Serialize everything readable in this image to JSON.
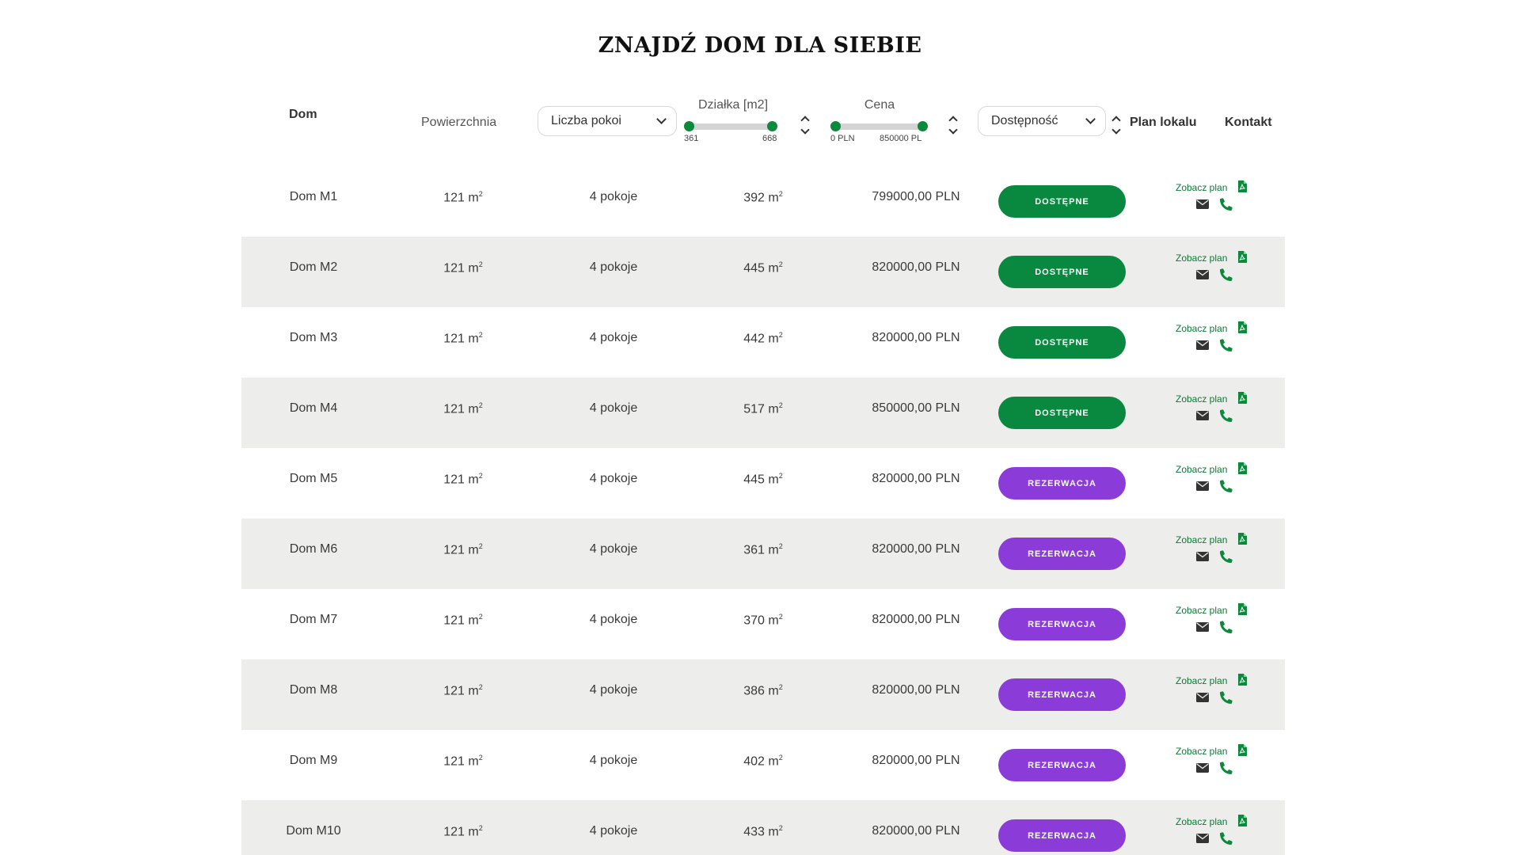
{
  "page_title": "ZNAJDŹ DOM DLA SIEBIE",
  "colors": {
    "accent_green": "#0a8a3a",
    "available": "#08893f",
    "reserved": "#8b3bd8",
    "row_alt_bg": "#ededec"
  },
  "header": {
    "dom": "Dom",
    "powierzchnia": "Powierzchnia",
    "rooms_select": {
      "selected": "Liczba pokoi"
    },
    "plot_range": {
      "label": "Działka [m2]",
      "min": "361",
      "max": "668"
    },
    "price_range": {
      "label": "Cena",
      "min": "0 PLN",
      "max": "850000 PL"
    },
    "availability_select": {
      "selected": "Dostępność"
    },
    "plan": "Plan lokalu",
    "kontakt": "Kontakt"
  },
  "rows": [
    {
      "name": "Dom M1",
      "area": "121 m",
      "rooms": "4 pokoje",
      "plot": "392 m",
      "price": "799000,00 PLN",
      "status": "DOSTĘPNE",
      "status_type": "available",
      "plan_link": "Zobacz plan"
    },
    {
      "name": "Dom M2",
      "area": "121 m",
      "rooms": "4 pokoje",
      "plot": "445 m",
      "price": "820000,00 PLN",
      "status": "DOSTĘPNE",
      "status_type": "available",
      "plan_link": "Zobacz plan"
    },
    {
      "name": "Dom M3",
      "area": "121 m",
      "rooms": "4 pokoje",
      "plot": "442 m",
      "price": "820000,00 PLN",
      "status": "DOSTĘPNE",
      "status_type": "available",
      "plan_link": "Zobacz plan"
    },
    {
      "name": "Dom M4",
      "area": "121 m",
      "rooms": "4 pokoje",
      "plot": "517 m",
      "price": "850000,00 PLN",
      "status": "DOSTĘPNE",
      "status_type": "available",
      "plan_link": "Zobacz plan"
    },
    {
      "name": "Dom M5",
      "area": "121 m",
      "rooms": "4 pokoje",
      "plot": "445 m",
      "price": "820000,00 PLN",
      "status": "REZERWACJA",
      "status_type": "reserved",
      "plan_link": "Zobacz plan"
    },
    {
      "name": "Dom M6",
      "area": "121 m",
      "rooms": "4 pokoje",
      "plot": "361 m",
      "price": "820000,00 PLN",
      "status": "REZERWACJA",
      "status_type": "reserved",
      "plan_link": "Zobacz plan"
    },
    {
      "name": "Dom M7",
      "area": "121 m",
      "rooms": "4 pokoje",
      "plot": "370 m",
      "price": "820000,00 PLN",
      "status": "REZERWACJA",
      "status_type": "reserved",
      "plan_link": "Zobacz plan"
    },
    {
      "name": "Dom M8",
      "area": "121 m",
      "rooms": "4 pokoje",
      "plot": "386 m",
      "price": "820000,00 PLN",
      "status": "REZERWACJA",
      "status_type": "reserved",
      "plan_link": "Zobacz plan"
    },
    {
      "name": "Dom M9",
      "area": "121 m",
      "rooms": "4 pokoje",
      "plot": "402 m",
      "price": "820000,00 PLN",
      "status": "REZERWACJA",
      "status_type": "reserved",
      "plan_link": "Zobacz plan"
    },
    {
      "name": "Dom M10",
      "area": "121 m",
      "rooms": "4 pokoje",
      "plot": "433 m",
      "price": "820000,00 PLN",
      "status": "REZERWACJA",
      "status_type": "reserved",
      "plan_link": "Zobacz plan"
    }
  ]
}
